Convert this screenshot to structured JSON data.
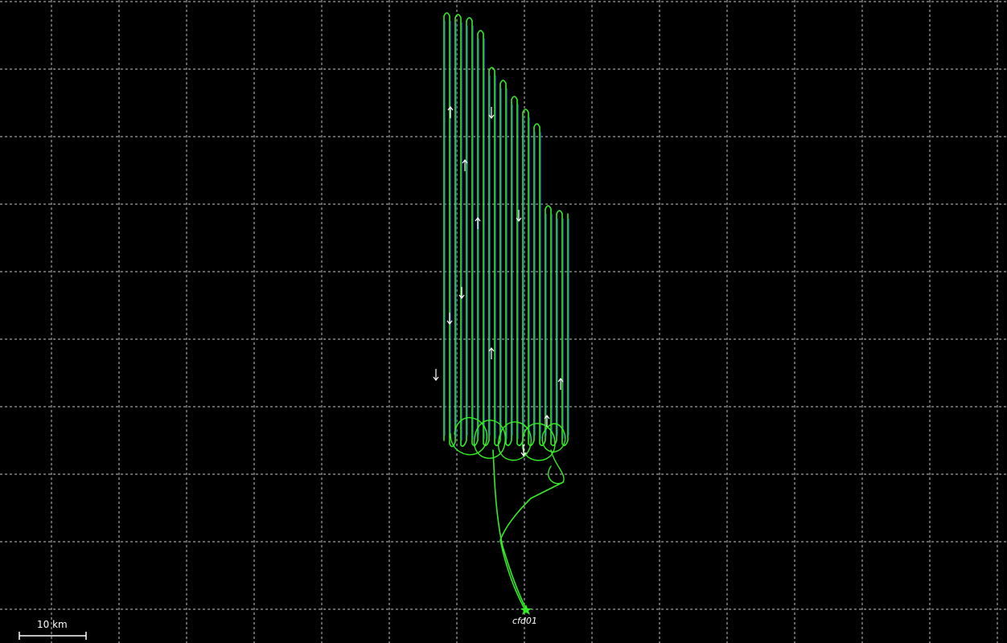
{
  "map": {
    "background_color": "#000000",
    "grid_color": "#c8c8c8",
    "grid_style": "dashed",
    "track_color": "#33ee22",
    "track_secondary_color": "#2255ff",
    "direction_arrow_color": "#ffffff",
    "marker": {
      "label": "cfd01",
      "icon": "star-marker-icon",
      "color": "#33ee22"
    },
    "scale_bar": {
      "label": "10 km",
      "color": "#ffffff"
    }
  }
}
